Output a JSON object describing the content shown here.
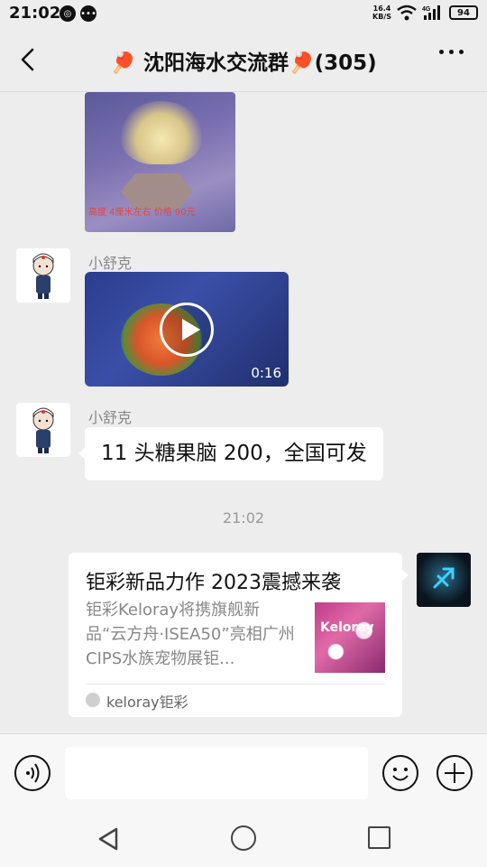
{
  "status_bar": {
    "time": "21:02",
    "net_speed_value": "16.4",
    "net_speed_unit": "KB/S",
    "network": "4G",
    "battery": "94"
  },
  "header": {
    "title": "🏓 沈阳海水交流群🏓(305)"
  },
  "messages": {
    "image_caption": "高度 4厘米左右 价格 90元",
    "video": {
      "sender": "小舒克",
      "duration": "0:16"
    },
    "text": {
      "sender": "小舒克",
      "content": "11 头糖果脑 200，全国可发"
    },
    "timestamp": "21:02",
    "card": {
      "title": "钜彩新品力作 2023震撼来袭",
      "description": "钜彩Keloray将携旗舰新品“云方舟·ISEA50”亮相广州CIPS水族宠物展钜...",
      "thumb_text": "Keloray",
      "source": "keloray钜彩"
    }
  },
  "input": {
    "placeholder": ""
  },
  "icons": [
    "back-icon",
    "more-icon",
    "play-icon",
    "voice-icon",
    "emoji-icon",
    "plus-icon",
    "nav-back-icon",
    "nav-home-icon",
    "nav-recent-icon"
  ]
}
